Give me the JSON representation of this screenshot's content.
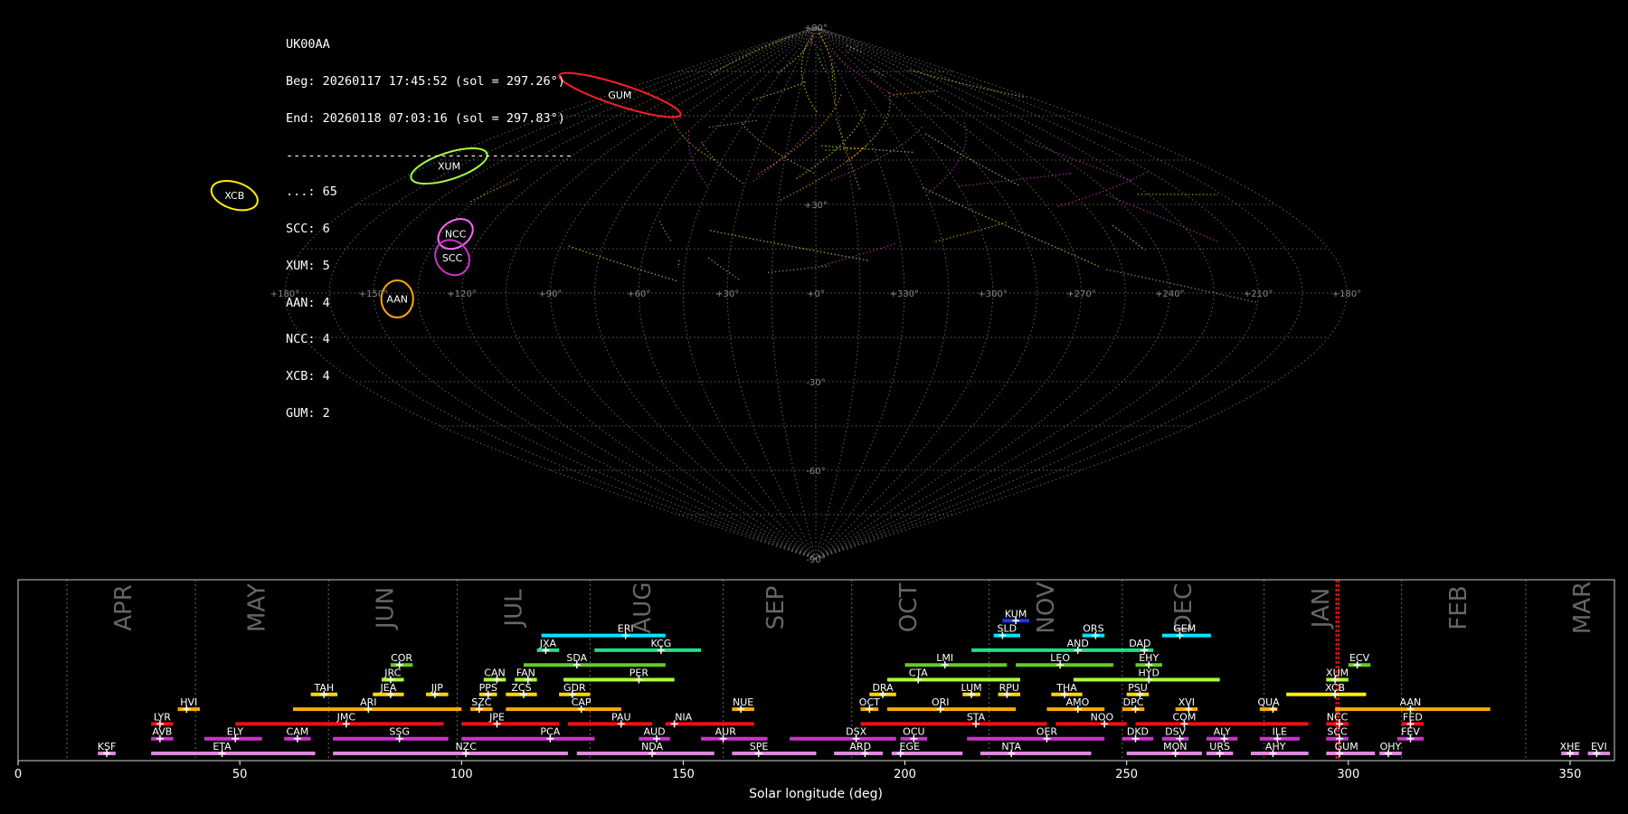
{
  "info": {
    "station": "UK00AA",
    "beg": "Beg: 20260117 17:45:52 (sol = 297.26°)",
    "end": "End: 20260118 07:03:16 (sol = 297.83°)",
    "separator": "---------------------------------------",
    "counts": [
      "...: 65",
      "SCC: 6",
      "XUM: 5",
      "AAN: 4",
      "NCC: 4",
      "XCB: 4",
      "GUM: 2"
    ]
  },
  "colors": {
    "background": "#000000",
    "grid": "#777777",
    "frame": "#cccccc",
    "month_label": "#666666",
    "sol_marker": "#ff2020",
    "text": "#ffffff"
  },
  "chart_data": [
    {
      "type": "scatter",
      "projection": "sinusoidal",
      "lon_labels": [
        "+180°",
        "+150°",
        "+120°",
        "+90°",
        "+60°",
        "+30°",
        "+0°",
        "+330°",
        "+300°",
        "+270°",
        "+240°",
        "+210°",
        "+180°"
      ],
      "lon_values": [
        180,
        150,
        120,
        90,
        60,
        30,
        0,
        -30,
        -60,
        -90,
        -120,
        -150,
        -180
      ],
      "lat_labels": [
        "+90°",
        "+30°",
        "-30°",
        "-60°",
        "-90°"
      ],
      "lat_values": [
        90,
        30,
        -30,
        -60,
        -90
      ],
      "shower_ellipses": [
        {
          "code": "XUM",
          "ra": 170,
          "dec": 43,
          "w": 15,
          "h": 5,
          "color": "#a8ff40"
        },
        {
          "code": "NCC",
          "ra": 130,
          "dec": 20,
          "w": 7,
          "h": 5,
          "color": "#ff66ff"
        },
        {
          "code": "SCC",
          "ra": 126,
          "dec": 12,
          "w": 6,
          "h": 7,
          "color": "#cc33cc"
        },
        {
          "code": "AAN",
          "ra": 142,
          "dec": -2,
          "w": 6,
          "h": 7,
          "color": "#ffaa00"
        },
        {
          "code": "GUM",
          "ra": 170,
          "dec": 67,
          "w": 24,
          "h": 4,
          "color": "#ff2020"
        },
        {
          "code": "XCB",
          "ra": 235,
          "dec": 33,
          "w": 9,
          "h": 5,
          "color": "#ffee00"
        }
      ]
    },
    {
      "type": "timeline",
      "xlabel": "Solar longitude (deg)",
      "xlim": [
        0,
        360
      ],
      "xticks": [
        0,
        50,
        100,
        150,
        200,
        250,
        300,
        350
      ],
      "month_labels": [
        {
          "name": "APR",
          "sol": 24
        },
        {
          "name": "MAY",
          "sol": 54
        },
        {
          "name": "JUN",
          "sol": 83
        },
        {
          "name": "JUL",
          "sol": 112
        },
        {
          "name": "AUG",
          "sol": 141
        },
        {
          "name": "SEP",
          "sol": 171
        },
        {
          "name": "OCT",
          "sol": 201
        },
        {
          "name": "NOV",
          "sol": 232
        },
        {
          "name": "DEC",
          "sol": 263
        },
        {
          "name": "JAN",
          "sol": 294
        },
        {
          "name": "FEB",
          "sol": 325
        },
        {
          "name": "MAR",
          "sol": 353
        }
      ],
      "month_boundaries": [
        11,
        40,
        70,
        99,
        129,
        159,
        188,
        219,
        249,
        281,
        312,
        340
      ],
      "sol_range": [
        297.26,
        297.83
      ],
      "showers": [
        {
          "code": "KSF",
          "start": 18,
          "end": 22,
          "peak": 20,
          "row": 0,
          "color": "#dd88dd"
        },
        {
          "code": "ETA",
          "start": 30,
          "end": 67,
          "peak": 46,
          "row": 0,
          "color": "#dd88dd"
        },
        {
          "code": "NZC",
          "start": 71,
          "end": 124,
          "peak": 101,
          "row": 0,
          "color": "#dd88dd"
        },
        {
          "code": "NDA",
          "start": 126,
          "end": 157,
          "peak": 143,
          "row": 0,
          "color": "#dd88dd"
        },
        {
          "code": "SPE",
          "start": 161,
          "end": 180,
          "peak": 167,
          "row": 0,
          "color": "#dd88dd"
        },
        {
          "code": "ARD",
          "start": 184,
          "end": 195,
          "peak": 191,
          "row": 0,
          "color": "#dd88dd"
        },
        {
          "code": "EGE",
          "start": 197,
          "end": 213,
          "peak": 199,
          "row": 0,
          "color": "#dd88dd"
        },
        {
          "code": "NTA",
          "start": 217,
          "end": 242,
          "peak": 224,
          "row": 0,
          "color": "#dd88dd"
        },
        {
          "code": "MON",
          "start": 250,
          "end": 267,
          "peak": 261,
          "row": 0,
          "color": "#dd88dd"
        },
        {
          "code": "URS",
          "start": 268,
          "end": 274,
          "peak": 271,
          "row": 0,
          "color": "#dd88dd"
        },
        {
          "code": "AHY",
          "start": 278,
          "end": 291,
          "peak": 283,
          "row": 0,
          "color": "#dd88dd"
        },
        {
          "code": "GUM",
          "start": 295,
          "end": 306,
          "peak": 298,
          "row": 0,
          "color": "#dd88dd"
        },
        {
          "code": "OHY",
          "start": 307,
          "end": 312,
          "peak": 309,
          "row": 0,
          "color": "#dd88dd"
        },
        {
          "code": "XHE",
          "start": 348,
          "end": 352,
          "peak": 350,
          "row": 0,
          "color": "#dd88dd"
        },
        {
          "code": "EVI",
          "start": 354,
          "end": 359,
          "peak": 356,
          "row": 0,
          "color": "#dd88dd"
        },
        {
          "code": "AVB",
          "start": 30,
          "end": 35,
          "peak": 32,
          "row": 1,
          "color": "#cc33cc"
        },
        {
          "code": "ELY",
          "start": 42,
          "end": 55,
          "peak": 49,
          "row": 1,
          "color": "#cc33cc"
        },
        {
          "code": "CAM",
          "start": 60,
          "end": 66,
          "peak": 63,
          "row": 1,
          "color": "#cc33cc"
        },
        {
          "code": "SSG",
          "start": 71,
          "end": 97,
          "peak": 86,
          "row": 1,
          "color": "#cc33cc"
        },
        {
          "code": "PCA",
          "start": 100,
          "end": 130,
          "peak": 120,
          "row": 1,
          "color": "#cc33cc"
        },
        {
          "code": "AUD",
          "start": 140,
          "end": 147,
          "peak": 144,
          "row": 1,
          "color": "#cc33cc"
        },
        {
          "code": "AUR",
          "start": 154,
          "end": 169,
          "peak": 159,
          "row": 1,
          "color": "#cc33cc"
        },
        {
          "code": "DSX",
          "start": 174,
          "end": 198,
          "peak": 189,
          "row": 1,
          "color": "#cc33cc"
        },
        {
          "code": "OCU",
          "start": 199,
          "end": 205,
          "peak": 202,
          "row": 1,
          "color": "#cc33cc"
        },
        {
          "code": "OER",
          "start": 214,
          "end": 245,
          "peak": 232,
          "row": 1,
          "color": "#cc33cc"
        },
        {
          "code": "DKD",
          "start": 249,
          "end": 256,
          "peak": 252,
          "row": 1,
          "color": "#cc33cc"
        },
        {
          "code": "DSV",
          "start": 258,
          "end": 264,
          "peak": 262,
          "row": 1,
          "color": "#cc33cc"
        },
        {
          "code": "ALY",
          "start": 268,
          "end": 275,
          "peak": 272,
          "row": 1,
          "color": "#cc33cc"
        },
        {
          "code": "ILE",
          "start": 280,
          "end": 289,
          "peak": 284,
          "row": 1,
          "color": "#cc33cc"
        },
        {
          "code": "SCC",
          "start": 295,
          "end": 300,
          "peak": 298,
          "row": 1,
          "color": "#cc33cc"
        },
        {
          "code": "FEV",
          "start": 311,
          "end": 317,
          "peak": 314,
          "row": 1,
          "color": "#cc33cc"
        },
        {
          "code": "LYR",
          "start": 30,
          "end": 35,
          "peak": 32,
          "row": 2,
          "color": "#ee1111"
        },
        {
          "code": "JMC",
          "start": 49,
          "end": 96,
          "peak": 74,
          "row": 2,
          "color": "#ee1111"
        },
        {
          "code": "JPE",
          "start": 100,
          "end": 122,
          "peak": 108,
          "row": 2,
          "color": "#ee1111"
        },
        {
          "code": "PAU",
          "start": 124,
          "end": 143,
          "peak": 136,
          "row": 2,
          "color": "#ee1111"
        },
        {
          "code": "NIA",
          "start": 146,
          "end": 166,
          "peak": 148,
          "row": 2,
          "color": "#ee1111"
        },
        {
          "code": "STA",
          "start": 190,
          "end": 232,
          "peak": 216,
          "row": 2,
          "color": "#ee1111"
        },
        {
          "code": "NOO",
          "start": 234,
          "end": 250,
          "peak": 245,
          "row": 2,
          "color": "#ee1111"
        },
        {
          "code": "COM",
          "start": 252,
          "end": 291,
          "peak": 263,
          "row": 2,
          "color": "#ee1111"
        },
        {
          "code": "NCC",
          "start": 295,
          "end": 300,
          "peak": 298,
          "row": 2,
          "color": "#ee1111"
        },
        {
          "code": "FED",
          "start": 312,
          "end": 317,
          "peak": 314,
          "row": 2,
          "color": "#ee1111"
        },
        {
          "code": "HVI",
          "start": 36,
          "end": 41,
          "peak": 38,
          "row": 3,
          "color": "#ffaa00"
        },
        {
          "code": "ARI",
          "start": 62,
          "end": 100,
          "peak": 79,
          "row": 3,
          "color": "#ffaa00"
        },
        {
          "code": "SZC",
          "start": 102,
          "end": 107,
          "peak": 104,
          "row": 3,
          "color": "#ffaa00"
        },
        {
          "code": "CAP",
          "start": 110,
          "end": 136,
          "peak": 127,
          "row": 3,
          "color": "#ffaa00"
        },
        {
          "code": "NUE",
          "start": 161,
          "end": 166,
          "peak": 163,
          "row": 3,
          "color": "#ffaa00"
        },
        {
          "code": "OCT",
          "start": 190,
          "end": 194,
          "peak": 192,
          "row": 3,
          "color": "#ffaa00"
        },
        {
          "code": "ORI",
          "start": 196,
          "end": 225,
          "peak": 208,
          "row": 3,
          "color": "#ffaa00"
        },
        {
          "code": "AMO",
          "start": 232,
          "end": 245,
          "peak": 239,
          "row": 3,
          "color": "#ffaa00"
        },
        {
          "code": "DPC",
          "start": 249,
          "end": 254,
          "peak": 252,
          "row": 3,
          "color": "#ffaa00"
        },
        {
          "code": "XVI",
          "start": 261,
          "end": 266,
          "peak": 264,
          "row": 3,
          "color": "#ffaa00"
        },
        {
          "code": "QUA",
          "start": 280,
          "end": 284,
          "peak": 283,
          "row": 3,
          "color": "#ffaa00"
        },
        {
          "code": "AAN",
          "start": 297,
          "end": 332,
          "peak": 314,
          "row": 3,
          "color": "#ffaa00"
        },
        {
          "code": "TAH",
          "start": 66,
          "end": 72,
          "peak": 69,
          "row": 4,
          "color": "#ffd700"
        },
        {
          "code": "JEA",
          "start": 80,
          "end": 87,
          "peak": 84,
          "row": 4,
          "color": "#ffd700"
        },
        {
          "code": "JIP",
          "start": 92,
          "end": 97,
          "peak": 94,
          "row": 4,
          "color": "#ffd700"
        },
        {
          "code": "PPS",
          "start": 104,
          "end": 108,
          "peak": 106,
          "row": 4,
          "color": "#ffd700"
        },
        {
          "code": "ZCS",
          "start": 110,
          "end": 117,
          "peak": 114,
          "row": 4,
          "color": "#ffd700"
        },
        {
          "code": "GDR",
          "start": 122,
          "end": 129,
          "peak": 125,
          "row": 4,
          "color": "#ffd700"
        },
        {
          "code": "DRA",
          "start": 192,
          "end": 198,
          "peak": 195,
          "row": 4,
          "color": "#ffd700"
        },
        {
          "code": "LUM",
          "start": 213,
          "end": 217,
          "peak": 215,
          "row": 4,
          "color": "#ffd700"
        },
        {
          "code": "RPU",
          "start": 221,
          "end": 226,
          "peak": 223,
          "row": 4,
          "color": "#ffd700"
        },
        {
          "code": "THA",
          "start": 233,
          "end": 240,
          "peak": 236,
          "row": 4,
          "color": "#ffd700"
        },
        {
          "code": "PSU",
          "start": 250,
          "end": 255,
          "peak": 253,
          "row": 4,
          "color": "#ffd700"
        },
        {
          "code": "XCB",
          "start": 286,
          "end": 304,
          "peak": 297,
          "row": 4,
          "color": "#ffee00"
        },
        {
          "code": "JRC",
          "start": 82,
          "end": 87,
          "peak": 84,
          "row": 5,
          "color": "#a8ff40"
        },
        {
          "code": "CAN",
          "start": 105,
          "end": 110,
          "peak": 108,
          "row": 5,
          "color": "#a8ff40"
        },
        {
          "code": "FAN",
          "start": 112,
          "end": 117,
          "peak": 115,
          "row": 5,
          "color": "#a8ff40"
        },
        {
          "code": "PER",
          "start": 123,
          "end": 148,
          "peak": 140,
          "row": 5,
          "color": "#a8ff40"
        },
        {
          "code": "CTA",
          "start": 196,
          "end": 226,
          "peak": 203,
          "row": 5,
          "color": "#a8ff40"
        },
        {
          "code": "HYD",
          "start": 238,
          "end": 271,
          "peak": 255,
          "row": 5,
          "color": "#a8ff40"
        },
        {
          "code": "XUM",
          "start": 295,
          "end": 300,
          "peak": 297,
          "row": 5,
          "color": "#a8ff40"
        },
        {
          "code": "COR",
          "start": 84,
          "end": 89,
          "peak": 86,
          "row": 6,
          "color": "#66cc22"
        },
        {
          "code": "SDA",
          "start": 114,
          "end": 146,
          "peak": 126,
          "row": 6,
          "color": "#66cc22"
        },
        {
          "code": "LMI",
          "start": 200,
          "end": 223,
          "peak": 209,
          "row": 6,
          "color": "#66cc22"
        },
        {
          "code": "LEO",
          "start": 225,
          "end": 247,
          "peak": 235,
          "row": 6,
          "color": "#66cc22"
        },
        {
          "code": "EHY",
          "start": 252,
          "end": 258,
          "peak": 255,
          "row": 6,
          "color": "#66cc22"
        },
        {
          "code": "ECV",
          "start": 300,
          "end": 305,
          "peak": 302,
          "row": 6,
          "color": "#66cc22"
        },
        {
          "code": "JXA",
          "start": 117,
          "end": 122,
          "peak": 119,
          "row": 7,
          "color": "#22dd88"
        },
        {
          "code": "KCG",
          "start": 130,
          "end": 154,
          "peak": 145,
          "row": 7,
          "color": "#22dd88"
        },
        {
          "code": "AND",
          "start": 215,
          "end": 250,
          "peak": 239,
          "row": 7,
          "color": "#22dd88"
        },
        {
          "code": "DAD",
          "start": 250,
          "end": 256,
          "peak": 254,
          "row": 7,
          "color": "#22dd88"
        },
        {
          "code": "ERI",
          "start": 118,
          "end": 146,
          "peak": 137,
          "row": 8,
          "color": "#00e5ff"
        },
        {
          "code": "SLD",
          "start": 220,
          "end": 226,
          "peak": 222,
          "row": 8,
          "color": "#00e5ff"
        },
        {
          "code": "ORS",
          "start": 240,
          "end": 245,
          "peak": 243,
          "row": 8,
          "color": "#00e5ff"
        },
        {
          "code": "GEM",
          "start": 258,
          "end": 269,
          "peak": 262,
          "row": 8,
          "color": "#00e5ff"
        },
        {
          "code": "KUM",
          "start": 222,
          "end": 228,
          "peak": 225,
          "row": 9,
          "color": "#2233ff"
        }
      ]
    }
  ]
}
